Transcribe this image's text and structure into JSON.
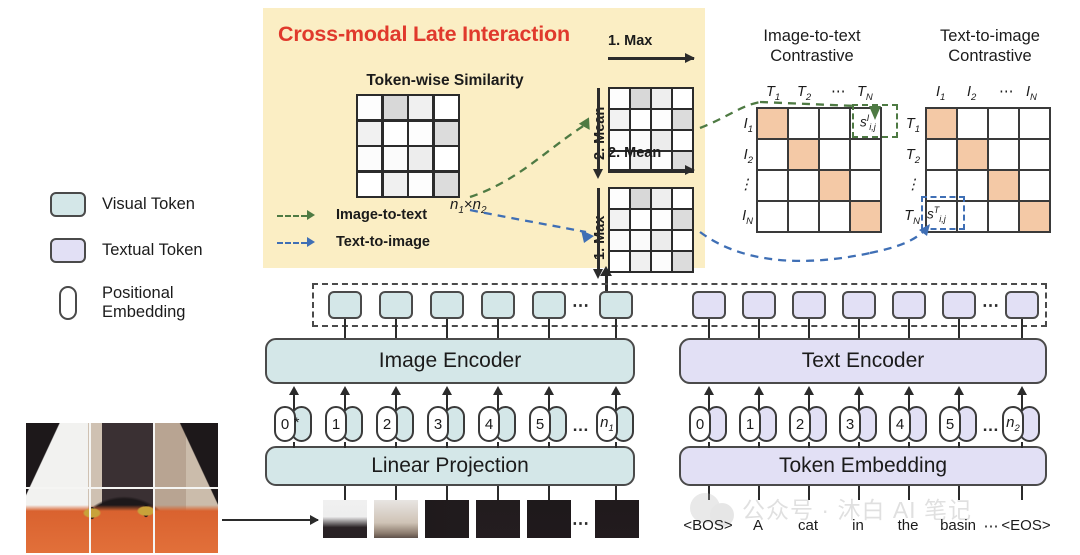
{
  "panel": {
    "title": "Cross-modal Late Interaction",
    "similarity_title": "Token-wise Similarity",
    "similarity_dims": "n1×n2",
    "legend": [
      {
        "label": "Image-to-text",
        "color": "#4e7a43"
      },
      {
        "label": "Text-to-image",
        "color": "#3f6fb5"
      }
    ],
    "top_matrix": {
      "h_label": "1. Max",
      "v_label": "2. Mean"
    },
    "bottom_matrix": {
      "h_label": "2. Mean",
      "v_label": "1. Max"
    },
    "bg_color": "#fbeec4",
    "title_color": "#e0392c"
  },
  "left_legend": [
    {
      "label": "Visual Token",
      "swatch": "rounded-rect",
      "color": "#d4e7e8"
    },
    {
      "label": "Textual Token",
      "swatch": "rounded-rect",
      "color": "#e2e0f5"
    },
    {
      "label": "Positional Embedding",
      "swatch": "pill",
      "color": "#ffffff"
    }
  ],
  "contrastive": [
    {
      "title_line1": "Image-to-text",
      "title_line2": "Contrastive",
      "col_labels": [
        "T1",
        "T2",
        "⋯",
        "TN"
      ],
      "row_labels": [
        "I1",
        "I2",
        "⋮",
        "IN"
      ],
      "diagonal_color": "#f4c9a6",
      "selected_cell": {
        "row": 0,
        "col": 3,
        "label": "s",
        "sub": "i,j",
        "sup": "I",
        "outline": "#4e7a43"
      }
    },
    {
      "title_line1": "Text-to-image",
      "title_line2": "Contrastive",
      "col_labels": [
        "I1",
        "I2",
        "⋯",
        "IN"
      ],
      "row_labels": [
        "T1",
        "T2",
        "⋮",
        "TN"
      ],
      "diagonal_color": "#f4c9a6",
      "selected_cell": {
        "row": 3,
        "col": 0,
        "label": "s",
        "sub": "i,j",
        "sup": "T",
        "outline": "#3f6fb5"
      }
    }
  ],
  "encoders": {
    "image_encoder": "Image Encoder",
    "text_encoder": "Text Encoder",
    "linear_projection": "Linear Projection",
    "token_embedding": "Token Embedding"
  },
  "image_stream": {
    "position_ids": [
      "0",
      "1",
      "2",
      "3",
      "4",
      "5",
      "…",
      "n1"
    ],
    "cls_marker": "*",
    "output_token_count": 6,
    "ellipsis": "⋯"
  },
  "text_stream": {
    "position_ids": [
      "0",
      "1",
      "2",
      "3",
      "4",
      "5",
      "…",
      "n2"
    ],
    "output_token_count": 7,
    "words": [
      "<BOS>",
      "A",
      "cat",
      "in",
      "the",
      "basin",
      "⋯",
      "<EOS>"
    ],
    "ellipsis": "⋯"
  },
  "watermark": {
    "text": "公众号 · 沐白 AI 笔记"
  },
  "chart_data": {
    "type": "heatmap",
    "title": "Token-wise Similarity",
    "grid_rows": 4,
    "grid_cols": 4,
    "similarity_values": [
      [
        0.05,
        0.62,
        0.22,
        0.03
      ],
      [
        0.2,
        0.04,
        0.05,
        0.55
      ],
      [
        0.06,
        0.05,
        0.26,
        0.04
      ],
      [
        0.04,
        0.2,
        0.05,
        0.5
      ]
    ]
  }
}
